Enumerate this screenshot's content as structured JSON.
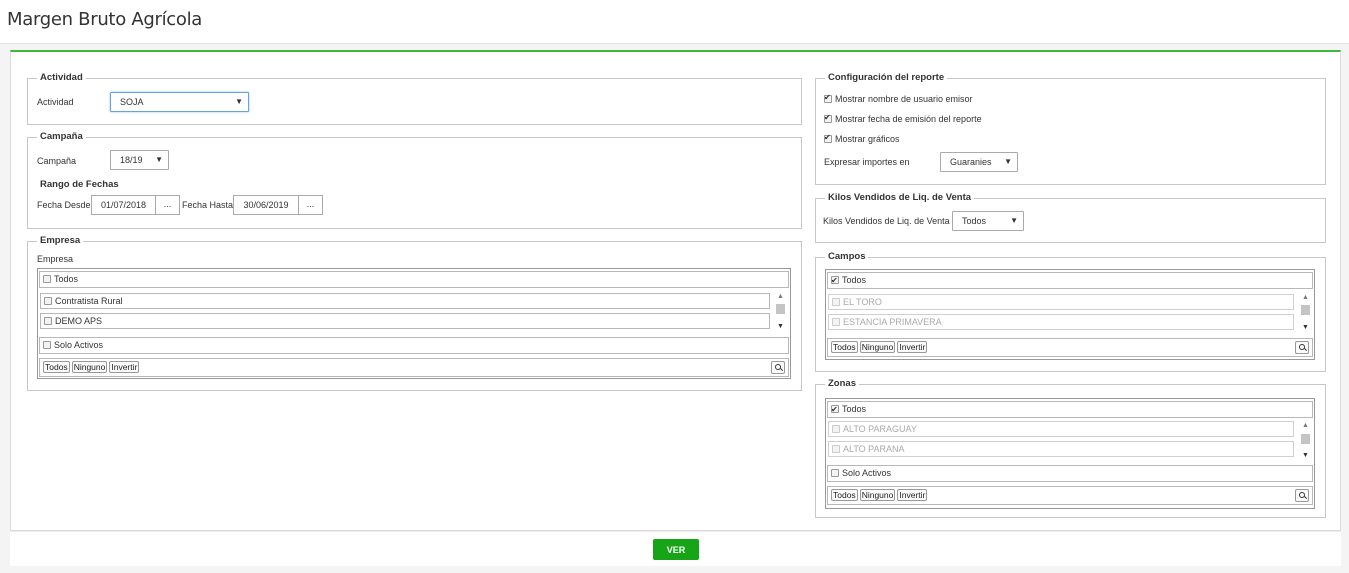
{
  "page": {
    "title": "Margen Bruto Agrícola"
  },
  "actividad": {
    "legend": "Actividad",
    "label": "Actividad",
    "value": "SOJA"
  },
  "campana": {
    "legend": "Campaña",
    "label": "Campaña",
    "value": "18/19",
    "range_title": "Rango de Fechas",
    "desde_label": "Fecha Desde",
    "desde_value": "01/07/2018",
    "hasta_label": "Fecha Hasta",
    "hasta_value": "30/06/2019",
    "picker_label": "..."
  },
  "empresa": {
    "legend": "Empresa",
    "label": "Empresa",
    "todos": "Todos",
    "items": [
      "Contratista Rural",
      "DEMO APS"
    ],
    "solo_activos": "Solo Activos",
    "btn_todos": "Todos",
    "btn_ninguno": "Ninguno",
    "btn_invertir": "Invertir"
  },
  "config": {
    "legend": "Configuración del reporte",
    "opt1": "Mostrar nombre de usuario emisor",
    "opt2": "Mostrar fecha de emisión del reporte",
    "opt3": "Mostrar gráficos",
    "importes_label": "Expresar importes en",
    "importes_value": "Guaranies"
  },
  "kilos": {
    "legend": "Kilos Vendidos de Liq. de Venta",
    "label": "Kilos Vendidos de Liq. de Venta",
    "value": "Todos"
  },
  "campos": {
    "legend": "Campos",
    "todos": "Todos",
    "items": [
      "EL TORO",
      "ESTANCIA PRIMAVERA"
    ],
    "btn_todos": "Todos",
    "btn_ninguno": "Ninguno",
    "btn_invertir": "Invertir"
  },
  "zonas": {
    "legend": "Zonas",
    "todos": "Todos",
    "items": [
      "ALTO PARAGUAY",
      "ALTO PARANA"
    ],
    "solo_activos": "Solo Activos",
    "btn_todos": "Todos",
    "btn_ninguno": "Ninguno",
    "btn_invertir": "Invertir"
  },
  "footer": {
    "ver": "VER"
  },
  "colors": {
    "accent": "#3cb93c",
    "button": "#17a417"
  }
}
